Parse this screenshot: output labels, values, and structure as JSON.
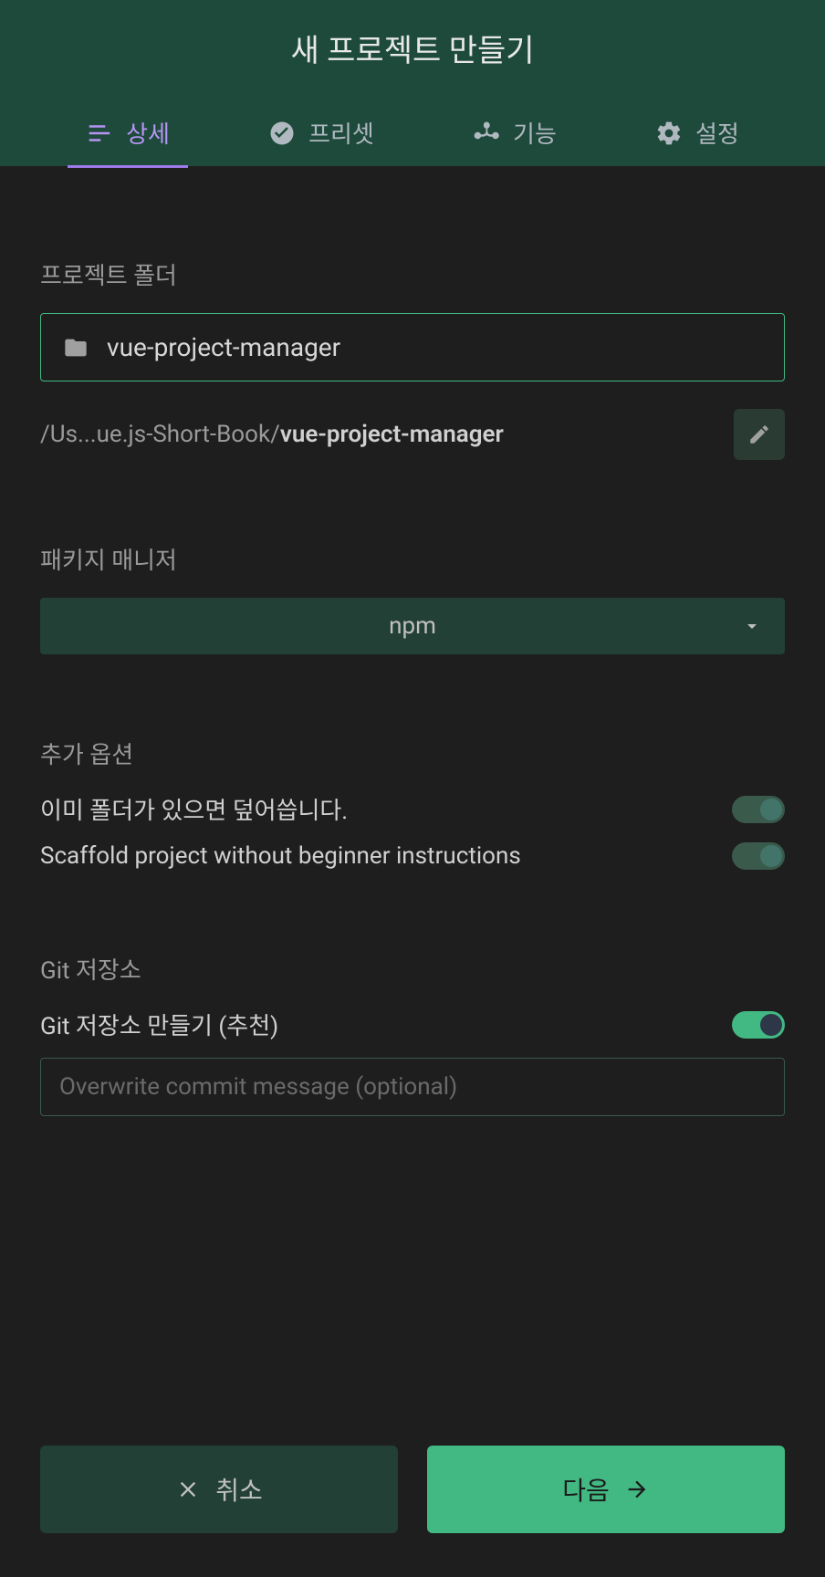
{
  "header": {
    "title": "새 프로젝트 만들기"
  },
  "tabs": [
    {
      "label": "상세",
      "icon": "list"
    },
    {
      "label": "프리셋",
      "icon": "check-circle"
    },
    {
      "label": "기능",
      "icon": "merge"
    },
    {
      "label": "설정",
      "icon": "gear"
    }
  ],
  "sections": {
    "folder": {
      "label": "프로젝트 폴더",
      "value": "vue-project-manager",
      "path_prefix": "/Us...ue.js-Short-Book/",
      "path_suffix": "vue-project-manager"
    },
    "package_manager": {
      "label": "패키지 매니저",
      "value": "npm"
    },
    "options": {
      "label": "추가 옵션",
      "items": [
        {
          "label": "이미 폴더가 있으면 덮어씁니다.",
          "state": "partial"
        },
        {
          "label": "Scaffold project without beginner instructions",
          "state": "partial"
        }
      ]
    },
    "git": {
      "label": "Git 저장소",
      "toggle_label": "Git 저장소 만들기 (추천)",
      "toggle_state": "on",
      "commit_placeholder": "Overwrite commit message (optional)"
    }
  },
  "footer": {
    "cancel": "취소",
    "next": "다음"
  }
}
